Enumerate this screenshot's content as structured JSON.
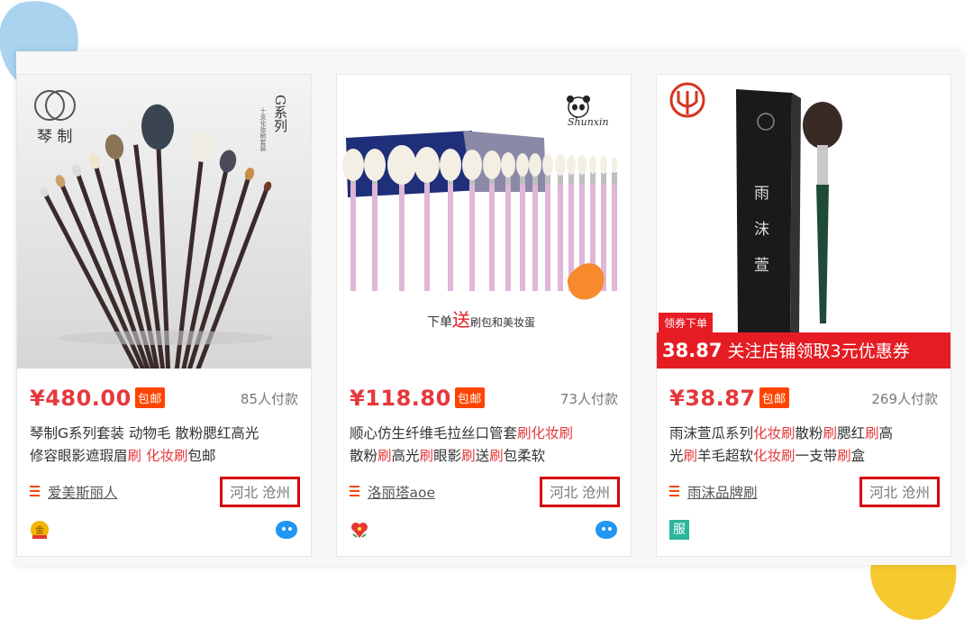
{
  "products": [
    {
      "price": "¥480.00",
      "tag": "包邮",
      "paid": "85人付款",
      "title_line1": "琴制G系列套装 动物毛 散粉腮红高光",
      "title_line2_a": "修容眼影遮瑕眉",
      "title_line2_b": "刷 化妆刷",
      "title_line2_c": "包邮",
      "shop": "爱美斯丽人",
      "location": "河北 沧州",
      "brand_logo": "琴 制",
      "series": "G系列",
      "series_sub": "十支化妆刷套装",
      "left_badge": "gold-medal-icon",
      "right_badge": "wangwang-chat-icon"
    },
    {
      "price": "¥118.80",
      "tag": "包邮",
      "paid": "73人付款",
      "title_line1_a": "顺心仿生纤维毛拉丝口管套",
      "title_line1_b": "刷化妆刷",
      "title_line2_a": "散粉",
      "title_line2_b": "刷",
      "title_line2_c": "高光",
      "title_line2_d": "刷",
      "title_line2_e": "眼影",
      "title_line2_f": "刷",
      "title_line2_g": "送",
      "title_line2_h": "刷",
      "title_line2_i": "包柔软",
      "shop": "洛丽塔aoe",
      "location": "河北 沧州",
      "brand_logo": "Shunxin",
      "caption_a": "下单",
      "caption_b": "送",
      "caption_c": "刷包和美妆蛋",
      "left_badge": "heart-flower-icon",
      "right_badge": "wangwang-chat-icon"
    },
    {
      "price": "¥38.87",
      "tag": "包邮",
      "paid": "269人付款",
      "title_line1_a": "雨沫萱瓜系列",
      "title_line1_b": "化妆刷",
      "title_line1_c": "散粉",
      "title_line1_d": "刷",
      "title_line1_e": "腮红",
      "title_line1_f": "刷",
      "title_line1_g": "高",
      "title_line2_a": "光",
      "title_line2_b": "刷",
      "title_line2_c": "羊毛超软",
      "title_line2_d": "化妆刷",
      "title_line2_e": "一支带",
      "title_line2_f": "刷",
      "title_line2_g": "盒",
      "shop": "雨沫品牌刷",
      "location": "河北 沧州",
      "box_text": [
        "雨",
        "沫",
        "萱"
      ],
      "promo_small": "领券下单",
      "promo_price": "38.87",
      "promo_text": " 关注店铺领取3元优惠券",
      "left_badge": "服"
    }
  ],
  "colors": {
    "accent_red": "#e4393c",
    "tag_orange": "#ff4400",
    "highlight_border": "#d9000d",
    "blob_blue": "#a9d3ef",
    "blob_yellow": "#f6c930"
  }
}
